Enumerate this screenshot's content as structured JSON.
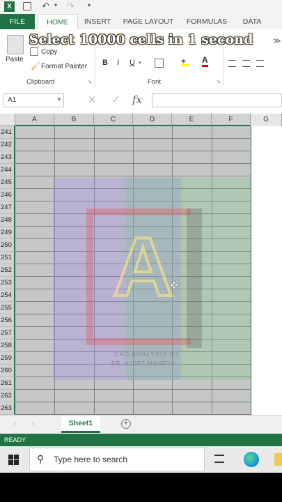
{
  "app": {
    "overlay_caption": "Select 10000 cells in 1 second",
    "tabs": [
      "FILE",
      "HOME",
      "INSERT",
      "PAGE LAYOUT",
      "FORMULAS",
      "DATA"
    ],
    "active_tab": "HOME"
  },
  "ribbon": {
    "paste_label": "Paste",
    "copy_label": "Copy",
    "format_painter_label": "Format Painter",
    "clipboard_group": "Clipboard",
    "font_group": "Font",
    "bold": "B",
    "italic": "I",
    "underline": "U"
  },
  "formula_bar": {
    "name_box": "A1",
    "fx": "fx",
    "formula": ""
  },
  "grid": {
    "columns": [
      "A",
      "B",
      "C",
      "D",
      "E",
      "F",
      "G"
    ],
    "rows": [
      "241",
      "242",
      "243",
      "244",
      "245",
      "246",
      "247",
      "248",
      "249",
      "250",
      "251",
      "252",
      "253",
      "254",
      "255",
      "256",
      "257",
      "258",
      "259",
      "260",
      "261",
      "262",
      "263"
    ],
    "watermark_text": "CAD ANALYSIS BY",
    "watermark_sub": "ER. AJEET MAURYA",
    "watermark_logo": "A"
  },
  "sheets": {
    "active": "Sheet1",
    "add_label": "+"
  },
  "status": {
    "mode": "READY"
  },
  "taskbar": {
    "search_placeholder": "Type here to search"
  },
  "colors": {
    "excel_green": "#217346",
    "selection_gray": "#c6c6c6"
  }
}
